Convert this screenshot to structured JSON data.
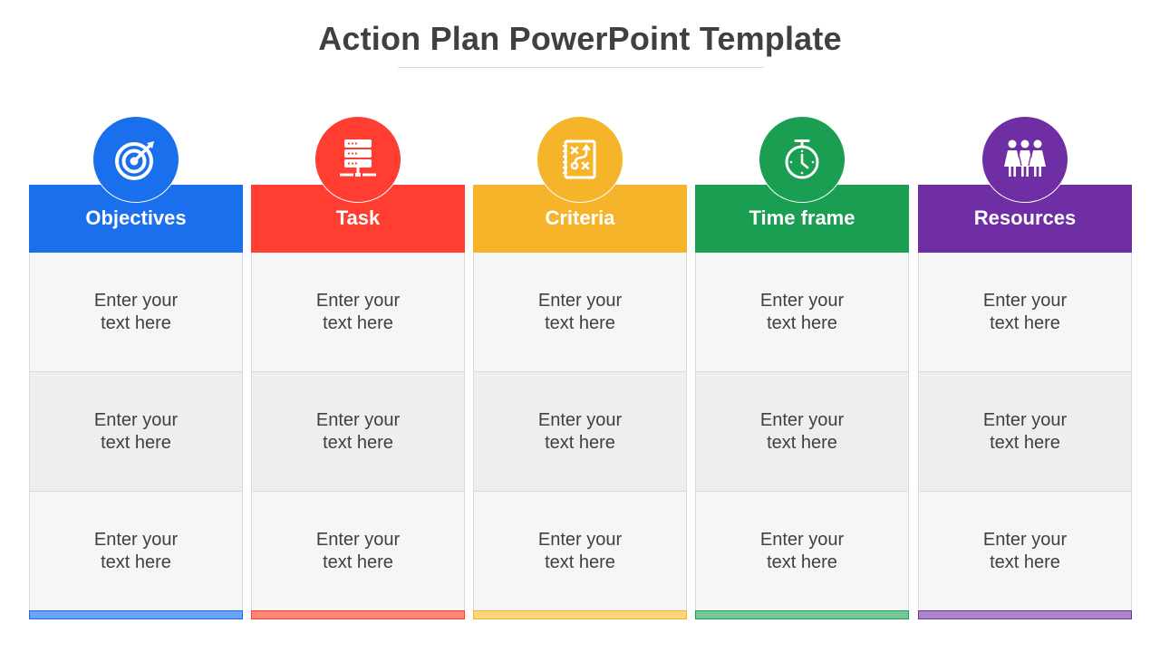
{
  "slide": {
    "title": "Action Plan PowerPoint Template"
  },
  "columns": [
    {
      "label": "Objectives",
      "icon": "target-icon",
      "color": "#1A6FEC",
      "footer_fill": "#6EA2F5",
      "cells": [
        "Enter your text here",
        "Enter your text here",
        "Enter your text here"
      ]
    },
    {
      "label": "Task",
      "icon": "server-network-icon",
      "color": "#FF3D30",
      "footer_fill": "#FF8578",
      "cells": [
        "Enter your text here",
        "Enter your text here",
        "Enter your text here"
      ]
    },
    {
      "label": "Criteria",
      "icon": "strategy-plan-icon",
      "color": "#F6B42A",
      "footer_fill": "#FBD57F",
      "cells": [
        "Enter your text here",
        "Enter your text here",
        "Enter your text here"
      ]
    },
    {
      "label": "Time frame",
      "icon": "stopwatch-icon",
      "color": "#1A9E52",
      "footer_fill": "#78C596",
      "cells": [
        "Enter your text here",
        "Enter your text here",
        "Enter your text here"
      ]
    },
    {
      "label": "Resources",
      "icon": "team-people-icon",
      "color": "#6F2EA3",
      "footer_fill": "#AB85CA",
      "cells": [
        "Enter your text here",
        "Enter your text here",
        "Enter your text here"
      ]
    }
  ]
}
